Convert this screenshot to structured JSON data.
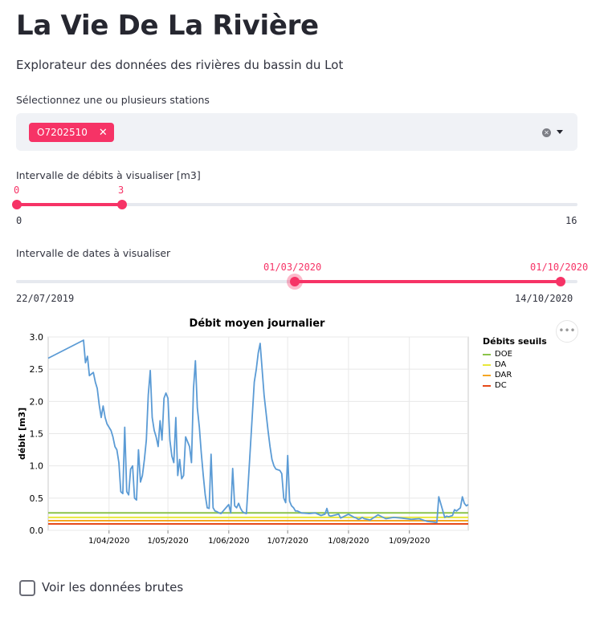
{
  "header": {
    "title": "La Vie De La Rivière",
    "subtitle": "Explorateur des données des rivières du bassin du Lot"
  },
  "stations": {
    "label": "Sélectionnez une ou plusieurs stations",
    "selected": "O7202510",
    "remove_glyph": "✕"
  },
  "flow_slider": {
    "label": "Intervalle de débits à visualiser [m3]",
    "value_low": "0",
    "value_high": "3",
    "min": "0",
    "max": "16",
    "low_fraction": 0,
    "high_fraction": 0.1875
  },
  "date_slider": {
    "label": "Intervalle de dates à visualiser",
    "value_low": "01/03/2020",
    "value_high": "01/10/2020",
    "min": "22/07/2019",
    "max": "14/10/2020",
    "low_fraction": 0.49,
    "high_fraction": 0.9795
  },
  "menu_glyph": "•••",
  "raw_data": {
    "label": "Voir les données brutes",
    "checked": false
  },
  "colors": {
    "accent": "#f63366",
    "line": "#5b9bd5",
    "DOE": "#8bc34a",
    "DA": "#e8e83a",
    "DAR": "#f5a623",
    "DC": "#e64a19"
  },
  "chart_data": {
    "type": "line",
    "title": "Débit moyen journalier",
    "xlabel": "",
    "ylabel": "débit [m3]",
    "ylim": [
      0,
      3
    ],
    "yticks": [
      "0.0",
      "0.5",
      "1.0",
      "1.5",
      "2.0",
      "2.5",
      "3.0"
    ],
    "xlim": [
      "2020-03-01",
      "2020-10-01"
    ],
    "xticks": [
      "1/04/2020",
      "1/05/2020",
      "1/06/2020",
      "1/07/2020",
      "1/08/2020",
      "1/09/2020"
    ],
    "grid": true,
    "legend": {
      "title": "Débits seuils",
      "placement": "right"
    },
    "thresholds": [
      {
        "name": "DOE",
        "value": 0.27
      },
      {
        "name": "DA",
        "value": 0.2
      },
      {
        "name": "DAR",
        "value": 0.15
      },
      {
        "name": "DC",
        "value": 0.1
      }
    ],
    "series": [
      {
        "x": [
          "2020-03-01",
          "2020-03-19",
          "2020-03-20",
          "2020-03-21",
          "2020-03-22",
          "2020-03-24",
          "2020-03-25",
          "2020-03-26",
          "2020-03-27",
          "2020-03-28",
          "2020-03-29",
          "2020-03-30",
          "2020-03-31",
          "2020-04-02",
          "2020-04-03",
          "2020-04-04",
          "2020-04-05",
          "2020-04-06",
          "2020-04-07",
          "2020-04-08",
          "2020-04-09",
          "2020-04-10",
          "2020-04-11",
          "2020-04-12",
          "2020-04-13",
          "2020-04-14",
          "2020-04-15",
          "2020-04-16",
          "2020-04-17",
          "2020-04-18",
          "2020-04-19",
          "2020-04-20",
          "2020-04-21",
          "2020-04-22",
          "2020-04-23",
          "2020-04-24",
          "2020-04-25",
          "2020-04-26",
          "2020-04-27",
          "2020-04-28",
          "2020-04-29",
          "2020-04-30",
          "2020-05-01",
          "2020-05-02",
          "2020-05-03",
          "2020-05-04",
          "2020-05-05",
          "2020-05-06",
          "2020-05-07",
          "2020-05-08",
          "2020-05-09",
          "2020-05-10",
          "2020-05-12",
          "2020-05-13",
          "2020-05-14",
          "2020-05-15",
          "2020-05-16",
          "2020-05-17",
          "2020-05-18",
          "2020-05-19",
          "2020-05-20",
          "2020-05-21",
          "2020-05-22",
          "2020-05-23",
          "2020-05-24",
          "2020-05-25",
          "2020-05-26",
          "2020-05-27",
          "2020-05-28",
          "2020-06-01",
          "2020-06-02",
          "2020-06-03",
          "2020-06-04",
          "2020-06-05",
          "2020-06-06",
          "2020-06-07",
          "2020-06-08",
          "2020-06-09",
          "2020-06-10",
          "2020-06-14",
          "2020-06-15",
          "2020-06-16",
          "2020-06-17",
          "2020-06-19",
          "2020-06-21",
          "2020-06-22",
          "2020-06-23",
          "2020-06-24",
          "2020-06-25",
          "2020-06-26",
          "2020-06-27",
          "2020-06-28",
          "2020-06-29",
          "2020-06-30",
          "2020-07-01",
          "2020-07-02",
          "2020-07-03",
          "2020-07-04",
          "2020-07-05",
          "2020-07-06",
          "2020-07-08",
          "2020-07-12",
          "2020-07-15",
          "2020-07-18",
          "2020-07-20",
          "2020-07-21",
          "2020-07-22",
          "2020-07-23",
          "2020-07-27",
          "2020-07-28",
          "2020-08-01",
          "2020-08-04",
          "2020-08-05",
          "2020-08-06",
          "2020-08-07",
          "2020-08-08",
          "2020-08-09",
          "2020-08-12",
          "2020-08-16",
          "2020-08-20",
          "2020-08-24",
          "2020-08-28",
          "2020-09-02",
          "2020-09-06",
          "2020-09-10",
          "2020-09-13",
          "2020-09-15",
          "2020-09-16",
          "2020-09-19",
          "2020-09-20",
          "2020-09-21",
          "2020-09-23",
          "2020-09-24",
          "2020-09-25",
          "2020-09-27",
          "2020-09-28",
          "2020-09-29",
          "2020-09-30",
          "2020-10-01"
        ],
        "y": [
          2.67,
          2.95,
          2.6,
          2.7,
          2.4,
          2.45,
          2.3,
          2.2,
          1.95,
          1.75,
          1.93,
          1.75,
          1.65,
          1.55,
          1.45,
          1.3,
          1.25,
          1.05,
          0.6,
          0.57,
          1.6,
          0.6,
          0.55,
          0.95,
          1.0,
          0.5,
          0.47,
          1.25,
          0.75,
          0.85,
          1.1,
          1.4,
          2.1,
          2.48,
          1.75,
          1.55,
          1.45,
          1.3,
          1.7,
          1.4,
          2.05,
          2.13,
          2.05,
          1.4,
          1.15,
          1.05,
          1.75,
          0.85,
          1.1,
          0.8,
          0.85,
          1.45,
          1.3,
          1.05,
          2.2,
          2.63,
          1.9,
          1.6,
          1.2,
          0.85,
          0.55,
          0.35,
          0.34,
          1.18,
          0.35,
          0.3,
          0.29,
          0.27,
          0.26,
          0.4,
          0.27,
          0.96,
          0.38,
          0.35,
          0.42,
          0.34,
          0.29,
          0.27,
          0.26,
          2.3,
          2.5,
          2.75,
          2.9,
          2.1,
          1.55,
          1.3,
          1.1,
          1.0,
          0.95,
          0.94,
          0.93,
          0.88,
          0.5,
          0.43,
          1.16,
          0.45,
          0.38,
          0.35,
          0.3,
          0.3,
          0.27,
          0.26,
          0.27,
          0.23,
          0.25,
          0.34,
          0.23,
          0.22,
          0.25,
          0.19,
          0.25,
          0.2,
          0.19,
          0.17,
          0.18,
          0.2,
          0.18,
          0.16,
          0.24,
          0.18,
          0.2,
          0.19,
          0.17,
          0.18,
          0.14,
          0.13,
          0.12,
          0.52,
          0.2,
          0.22,
          0.21,
          0.23,
          0.32,
          0.3,
          0.35,
          0.52,
          0.42,
          0.38,
          0.4
        ]
      }
    ]
  }
}
